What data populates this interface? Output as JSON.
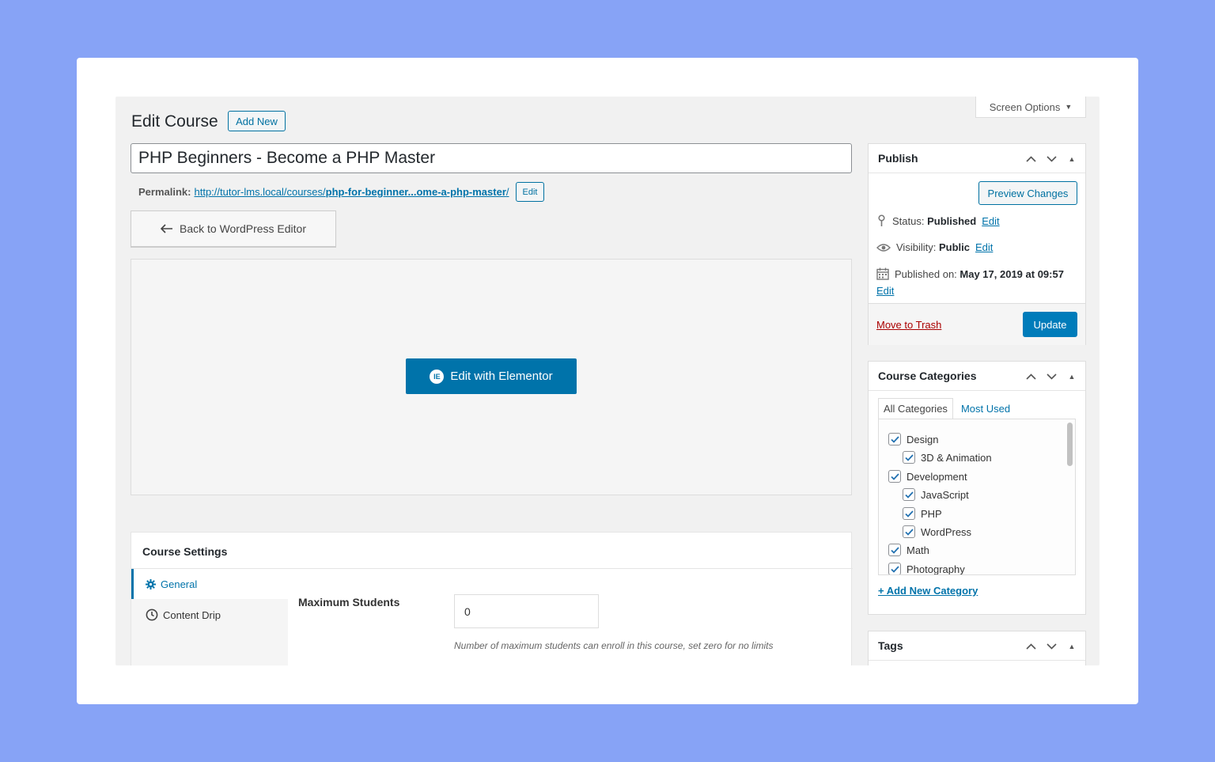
{
  "header": {
    "screen_options": "Screen Options",
    "page_title": "Edit Course",
    "add_new": "Add New"
  },
  "editor": {
    "post_title": "PHP Beginners - Become a PHP Master",
    "permalink_label": "Permalink:",
    "permalink_base": "http://tutor-lms.local/courses/",
    "permalink_slug": "php-for-beginner...ome-a-php-master",
    "permalink_trailing": "/",
    "permalink_edit": "Edit",
    "back_button": "Back to WordPress Editor",
    "elementor_button": "Edit with Elementor"
  },
  "course_settings": {
    "title": "Course Settings",
    "tabs": [
      {
        "label": "General",
        "icon": "gear-icon"
      },
      {
        "label": "Content Drip",
        "icon": "clock-icon"
      }
    ],
    "max_students_label": "Maximum Students",
    "max_students_value": "0",
    "max_students_help": "Number of maximum students can enroll in this course, set zero for no limits"
  },
  "publish": {
    "title": "Publish",
    "preview_button": "Preview Changes",
    "status_label": "Status:",
    "status_value": "Published",
    "visibility_label": "Visibility:",
    "visibility_value": "Public",
    "published_on_label": "Published on:",
    "published_on_value": "May 17, 2019 at 09:57",
    "edit_label": "Edit",
    "trash_label": "Move to Trash",
    "update_button": "Update"
  },
  "categories": {
    "title": "Course Categories",
    "tab_all": "All Categories",
    "tab_most_used": "Most Used",
    "items": [
      {
        "label": "Design",
        "checked": true,
        "level": 0
      },
      {
        "label": "3D & Animation",
        "checked": true,
        "level": 1
      },
      {
        "label": "Development",
        "checked": true,
        "level": 0
      },
      {
        "label": "JavaScript",
        "checked": true,
        "level": 1
      },
      {
        "label": "PHP",
        "checked": true,
        "level": 1
      },
      {
        "label": "WordPress",
        "checked": true,
        "level": 1
      },
      {
        "label": "Math",
        "checked": true,
        "level": 0
      },
      {
        "label": "Photography",
        "checked": true,
        "level": 0
      }
    ],
    "add_new": "+ Add New Category"
  },
  "tags": {
    "title": "Tags"
  },
  "colors": {
    "accent": "#0073aa",
    "primary_button": "#007cba",
    "trash": "#aa0000",
    "backdrop": "#87a3f6"
  }
}
